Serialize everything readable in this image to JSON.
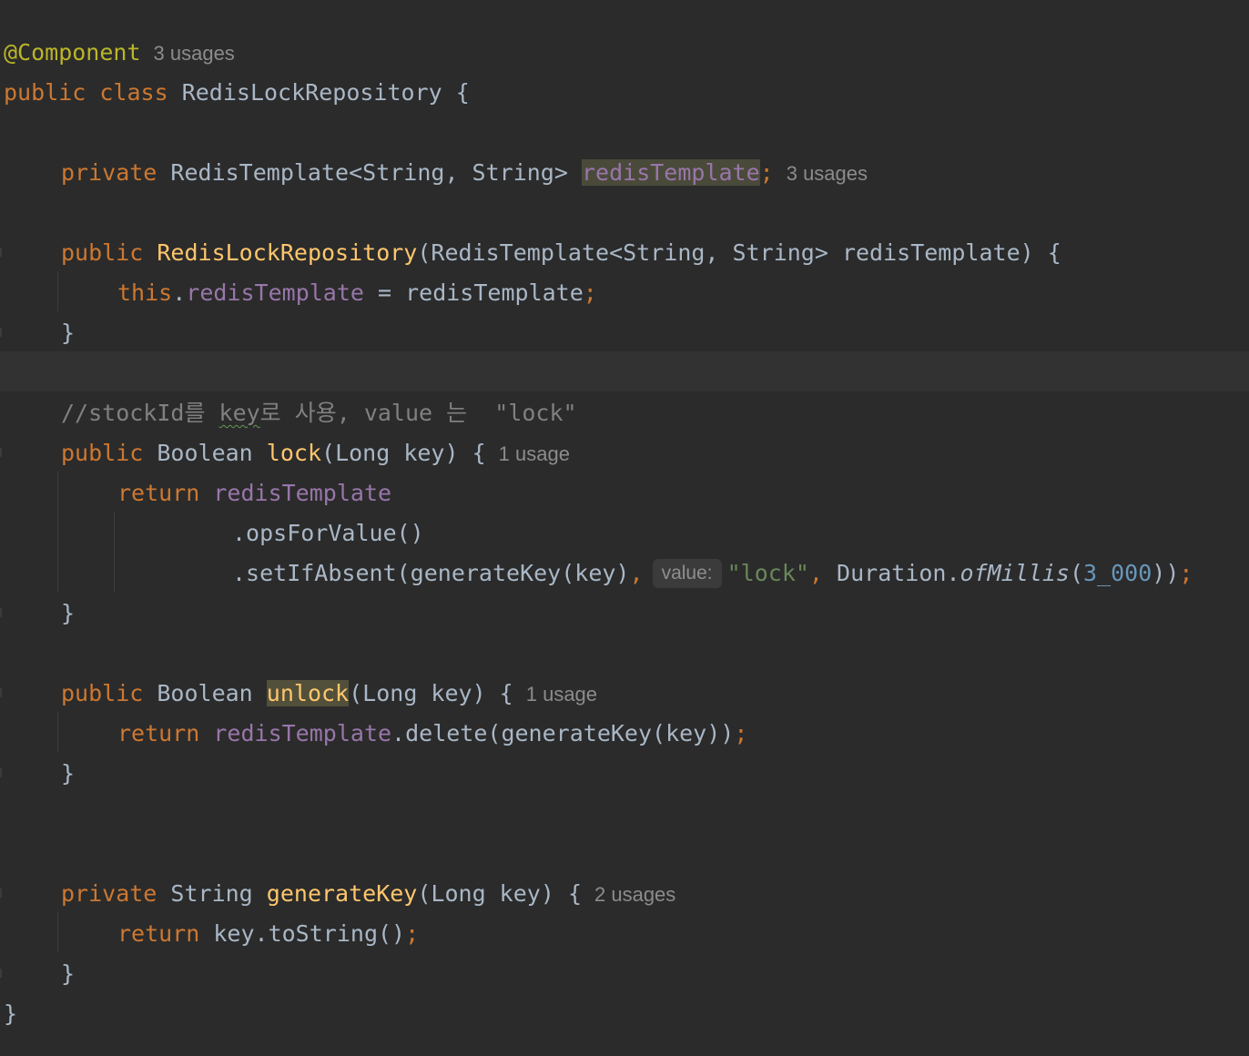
{
  "code": {
    "annotation": "@Component",
    "class_usages": "3 usages",
    "kw_public": "public",
    "kw_private": "private",
    "kw_class": "class",
    "kw_this": "this",
    "kw_return": "return",
    "class_name": "RedisLockRepository",
    "field_type": "RedisTemplate<String, String>",
    "field_name": "redisTemplate",
    "field_usages": "3 usages",
    "ctor_params": "(RedisTemplate<String, String> redisTemplate) {",
    "ctor_rhs": " = redisTemplate",
    "comment_prefix": "//stockId를 ",
    "comment_key": "key",
    "comment_suffix": "로 사용, value 는  \"lock\"",
    "lock_return_type": "Boolean",
    "lock_name": "lock",
    "lock_params": "(Long key) {",
    "lock_usages": "1 usage",
    "ops_call": ".opsForValue()",
    "set_call": ".setIfAbsent(generateKey(key)",
    "param_hint": "value:",
    "lock_string": "\"lock\"",
    "duration_class": "Duration.",
    "duration_method": "ofMillis",
    "duration_value": "3_000",
    "unlock_return_type": "Boolean",
    "unlock_name": "unlock",
    "unlock_params": "(Long key) {",
    "unlock_usages": "1 usage",
    "delete_call": ".delete(generateKey(key))",
    "gen_return_type": "String",
    "gen_name": "generateKey",
    "gen_params": "(Long key) {",
    "gen_usages": "2 usages",
    "gen_body": "key.toString()"
  }
}
